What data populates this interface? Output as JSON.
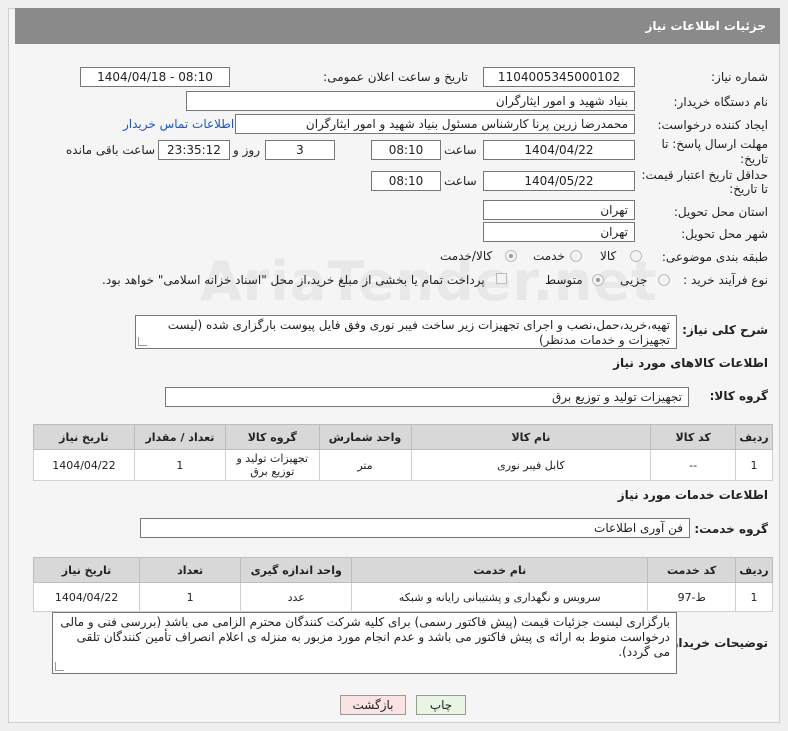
{
  "header": {
    "title": "جزئیات اطلاعات نیاز"
  },
  "form": {
    "need_number_label": "شماره نیاز:",
    "need_number": "1104005345000102",
    "announce_label": "تاریخ و ساعت اعلان عمومی:",
    "announce_value": "1404/04/18 - 08:10",
    "buyer_org_label": "نام دستگاه خریدار:",
    "buyer_org": "بنیاد شهید و امور ایثارگران",
    "requester_label": "ایجاد کننده درخواست:",
    "requester": "محمدرضا زرین پرنا کارشناس مسئول  بنیاد شهید و امور ایثارگران",
    "contact_link": "اطلاعات تماس خریدار",
    "reply_deadline_label_1": "مهلت ارسال پاسخ: تا",
    "reply_deadline_label_2": "تاریخ:",
    "reply_date": "1404/04/22",
    "time_label": "ساعت",
    "reply_time": "08:10",
    "days": "3",
    "days_label": "روز و",
    "remaining_time": "23:35:12",
    "remaining_label": "ساعت باقی مانده",
    "price_validity_label_1": "حداقل تاریخ اعتبار قیمت:",
    "price_validity_label_2": "تا تاریخ:",
    "validity_date": "1404/05/22",
    "validity_time": "08:10",
    "province_label": "استان محل تحویل:",
    "province": "تهران",
    "city_label": "شهر محل تحویل:",
    "city": "تهران",
    "category_label": "طبقه بندی موضوعی:",
    "category_options": [
      "کالا",
      "خدمت",
      "کالا/خدمت"
    ],
    "process_label": "نوع فرآیند خرید :",
    "process_options": [
      "جزیی",
      "متوسط"
    ],
    "payment_note": "پرداخت تمام یا بخشی از مبلغ خرید،از محل \"اسناد خزانه اسلامی\" خواهد بود."
  },
  "description": {
    "label": "شرح کلی نیاز:",
    "text": "تهیه،خرید،حمل،نصب و اجرای تجهیزات زیر ساخت فیبر نوری وفق فایل پیوست بارگزاری شده (لیست تجهیزات و خدمات مدنظر)"
  },
  "goods": {
    "section_title": "اطلاعات کالاهای مورد نیاز",
    "group_label": "گروه کالا:",
    "group_value": "تجهیزات تولید و توزیع برق",
    "columns": [
      "ردیف",
      "کد کالا",
      "نام کالا",
      "واحد شمارش",
      "گروه کالا",
      "تعداد / مقدار",
      "تاریخ نیاز"
    ],
    "rows": [
      {
        "row": "1",
        "code": "--",
        "name": "کابل فیبر نوری",
        "unit": "متر",
        "group": "تجهیزات تولید و توزیع برق",
        "qty": "1",
        "date": "1404/04/22"
      }
    ]
  },
  "services": {
    "section_title": "اطلاعات خدمات مورد نیاز",
    "group_label": "گروه خدمت:",
    "group_value": "فن آوری اطلاعات",
    "columns": [
      "ردیف",
      "کد خدمت",
      "نام خدمت",
      "واحد اندازه گیری",
      "تعداد",
      "تاریخ نیاز"
    ],
    "rows": [
      {
        "row": "1",
        "code": "ط-97",
        "name": "سرویس و نگهداری و پشتیبانی رایانه و شبکه",
        "unit": "عدد",
        "qty": "1",
        "date": "1404/04/22"
      }
    ]
  },
  "buyer_notes": {
    "label": "توضیحات خریدار:",
    "text": "بارگزاری لیست جزئیات قیمت (پیش فاکتور رسمی) برای کلیه شرکت کنندگان محترم الزامی می باشد (بررسی فنی و مالی درخواست منوط به ارائه ی پیش فاکتور می باشد و عدم انجام مورد مزبور به منزله ی اعلام انصراف تأمین کنندگان تلقی می گردد)."
  },
  "buttons": {
    "print": "چاپ",
    "back": "بازگشت"
  },
  "watermark": "AriaTender.net",
  "colors": {
    "title_bar": "#8a8a8a",
    "link": "#1a56c4",
    "back_button": "#fbe3e3",
    "print_button": "#e8f5e3"
  }
}
